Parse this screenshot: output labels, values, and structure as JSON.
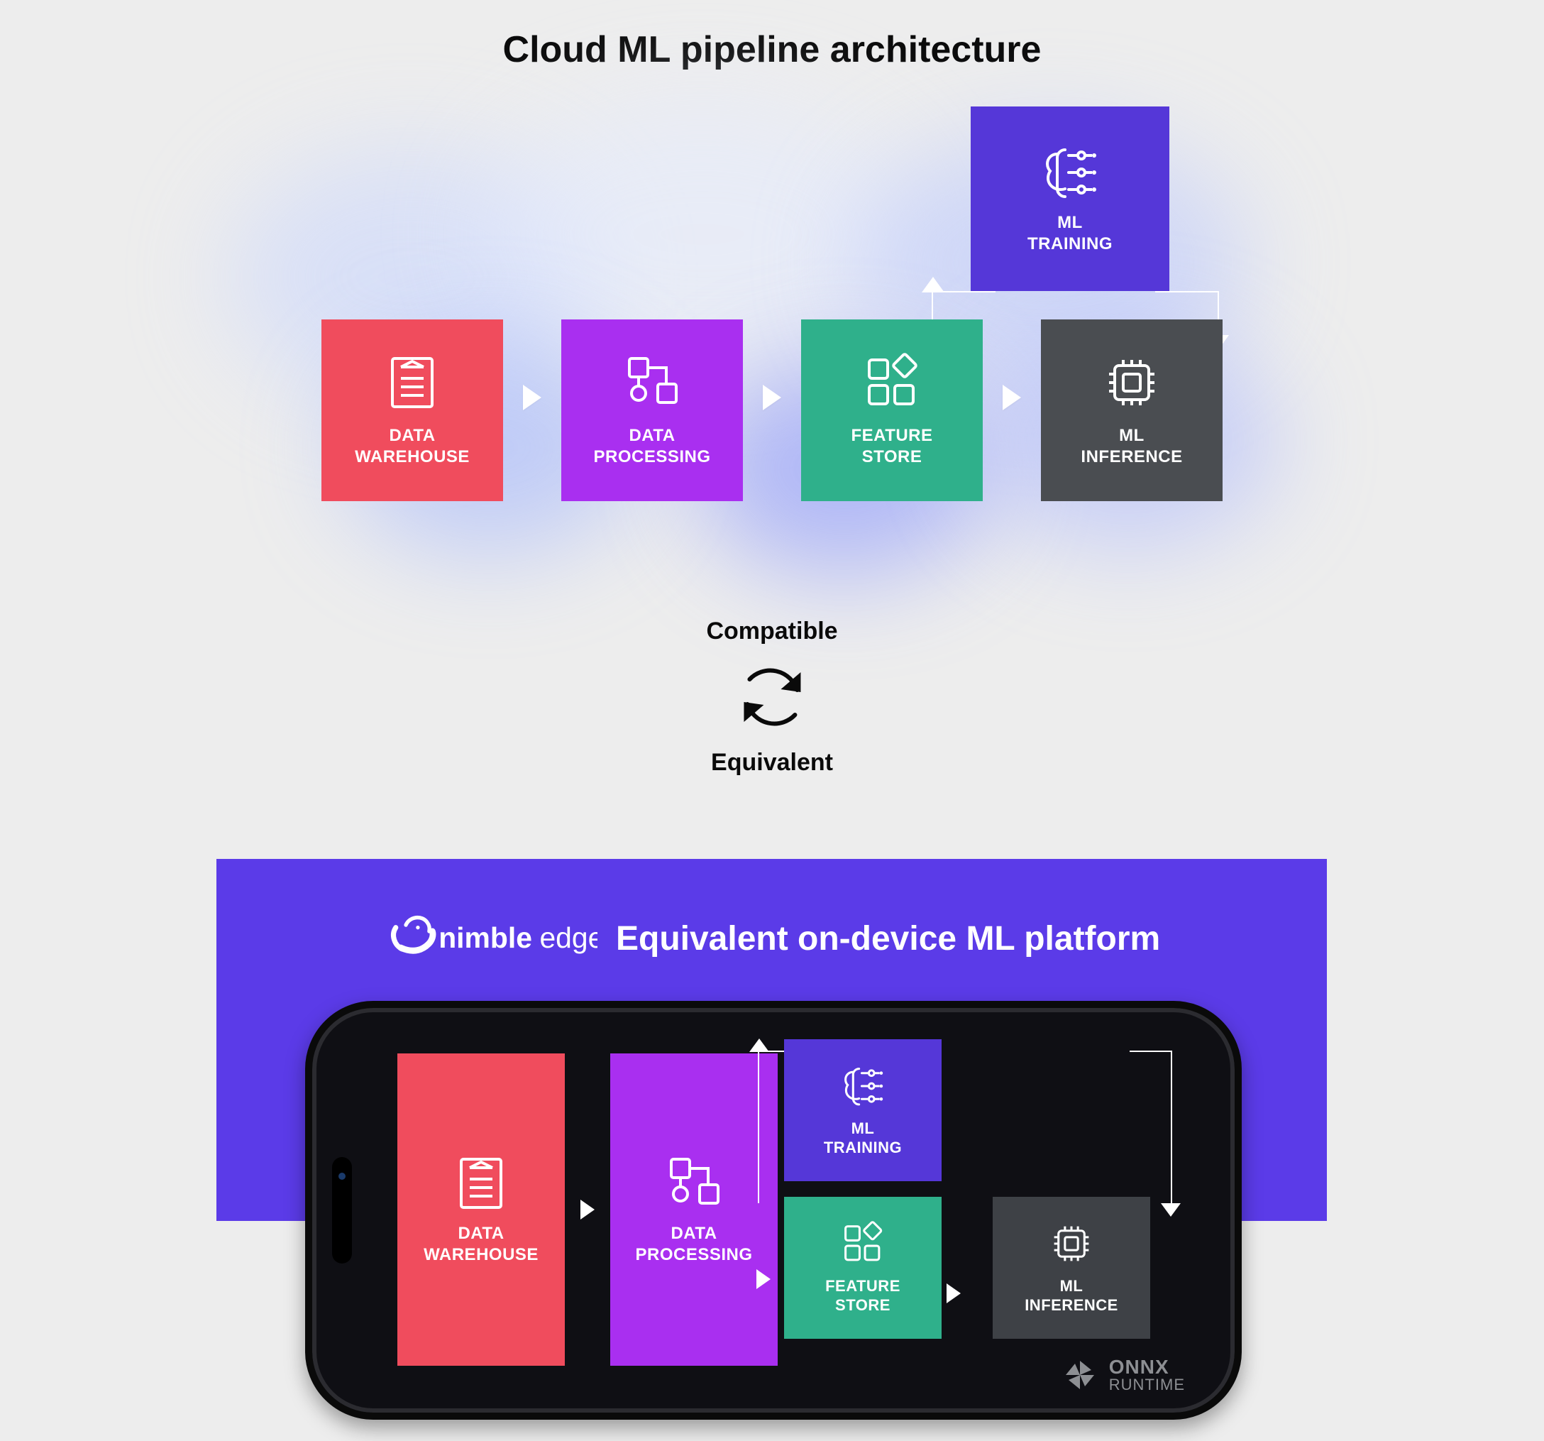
{
  "titles": {
    "cloud": "Cloud ML pipeline architecture",
    "device": "Equivalent on-device ML platform"
  },
  "compat": {
    "top": "Compatible",
    "bottom": "Equivalent"
  },
  "brand": {
    "name": "nimbleedge"
  },
  "pipeline": {
    "data_warehouse": {
      "label": "DATA\nWAREHOUSE",
      "icon": "warehouse-icon",
      "color": "#f04c5d"
    },
    "data_processing": {
      "label": "DATA\nPROCESSING",
      "icon": "processing-icon",
      "color": "#a92ff0"
    },
    "feature_store": {
      "label": "FEATURE\nSTORE",
      "icon": "features-icon",
      "color": "#2fb08b"
    },
    "ml_inference": {
      "label": "ML\nINFERENCE",
      "icon": "chip-icon",
      "color": "#4a4d51"
    },
    "ml_training": {
      "label": "ML\nTRAINING",
      "icon": "brain-icon",
      "color": "#5537d8"
    }
  },
  "runtime": {
    "line1": "ONNX",
    "line2": "RUNTIME"
  }
}
